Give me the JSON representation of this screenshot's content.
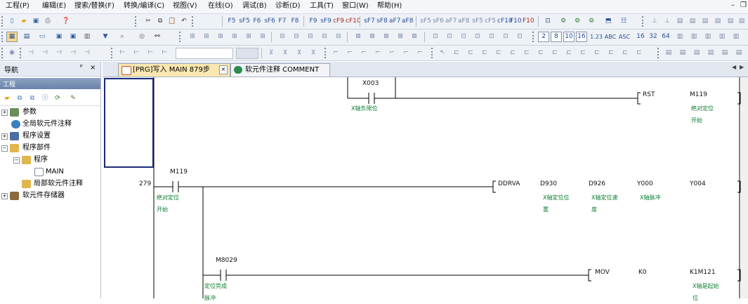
{
  "menu": [
    "工程(P)",
    "编辑(E)",
    "搜索/替换(F)",
    "转换/编译(C)",
    "视图(V)",
    "在线(O)",
    "调试(B)",
    "诊断(D)",
    "工具(T)",
    "窗口(W)",
    "帮助(H)"
  ],
  "window_controls": {
    "minimize": "–",
    "restore": "❐"
  },
  "toolbar1": {
    "func_keys": [
      "F5",
      "sF5",
      "F6",
      "sF6",
      "F7",
      "F8",
      "F9",
      "sF9",
      "cF9",
      "cF10",
      "sF7",
      "sF8",
      "aF7",
      "aF8",
      "sF5",
      "sF6",
      "aF7",
      "aF8",
      "sF5",
      "cF5",
      "cF10",
      "F10",
      "F10"
    ]
  },
  "toolbar2": {
    "device_buttons": [
      "2",
      "8",
      "10",
      "16",
      "1.23",
      "ABC",
      "ASC",
      "16",
      "32",
      "64"
    ]
  },
  "nav": {
    "title": "导航",
    "pin": "ᵖ",
    "close": "×",
    "project_header": "工程",
    "tree": [
      {
        "label": "参数",
        "expander": "+"
      },
      {
        "label": "全局软元件注释",
        "expander": ""
      },
      {
        "label": "程序设置",
        "expander": "+"
      },
      {
        "label": "程序部件",
        "expander": "−"
      },
      {
        "label": "程序",
        "expander": "−"
      },
      {
        "label": "MAIN",
        "expander": ""
      },
      {
        "label": "局部软元件注释",
        "expander": ""
      },
      {
        "label": "软元件存储器",
        "expander": "+"
      }
    ]
  },
  "tabs": [
    {
      "label": "[PRG]写入 MAIN 879步",
      "close": "×",
      "active": true
    },
    {
      "label": "软元件注释 COMMENT",
      "active": false
    }
  ],
  "tab_scroll": {
    "left": "◀",
    "right": "▶"
  },
  "ladder": {
    "rung1": {
      "contact": {
        "device": "X003",
        "comment": "X轴负限位"
      },
      "coil": {
        "instruction": "RST",
        "operand": "M119",
        "comment": [
          "绝对定位",
          "开始"
        ]
      }
    },
    "rung2": {
      "step": "279",
      "contact": {
        "device": "M119",
        "comment": [
          "绝对定位",
          "开始"
        ]
      },
      "instruction": "DDRVA",
      "operands": [
        {
          "device": "D930",
          "comment": [
            "X轴定位位",
            "置"
          ]
        },
        {
          "device": "D926",
          "comment": [
            "X轴定位速",
            "度"
          ]
        },
        {
          "device": "Y000",
          "comment": [
            "X轴脉冲"
          ]
        },
        {
          "device": "Y004",
          "comment": []
        }
      ]
    },
    "rung3": {
      "contact": {
        "device": "M8029",
        "comment": [
          "定位完成",
          "脉冲"
        ]
      },
      "instruction": "MOV",
      "operands": [
        {
          "device": "K0",
          "comment": []
        },
        {
          "device": "K1M121",
          "comment": [
            "X轴是起始",
            "位"
          ]
        }
      ]
    }
  },
  "colors": {
    "comment": "#0a7d2e",
    "active_tab": "#fbe8b0",
    "cursor": "#1a2a7a"
  }
}
